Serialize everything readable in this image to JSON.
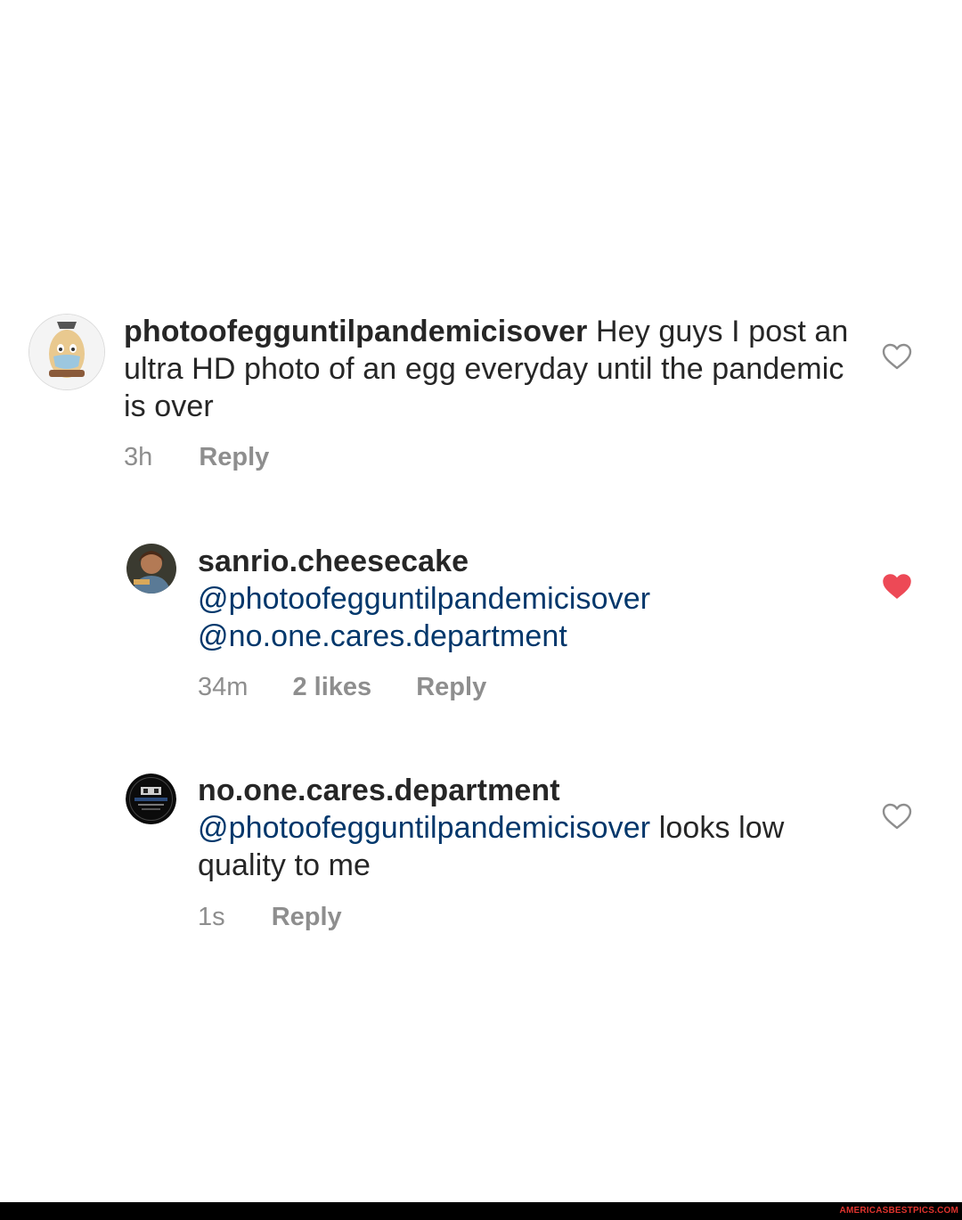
{
  "comments": [
    {
      "username": "photoofegguntilpandemicisover",
      "text": " Hey guys I post an ultra HD photo of an egg everyday until the pandemic is over",
      "time": "3h",
      "reply_label": "Reply",
      "liked": false
    },
    {
      "username": "sanrio.cheesecake",
      "mention1": "@photoofegguntilpandemicisover",
      "mention2": "@no.one.cares.department",
      "time": "34m",
      "likes": "2 likes",
      "reply_label": "Reply",
      "liked": true
    },
    {
      "username": "no.one.cares.department",
      "mention1": "@photoofegguntilpandemicisover",
      "text": " looks low quality to me",
      "time": "1s",
      "reply_label": "Reply",
      "liked": false
    }
  ],
  "watermark": "AMERICASBESTPICS.COM",
  "colors": {
    "heart_liked": "#ed4956",
    "heart_outline": "#8e8e8e",
    "mention": "#00376b",
    "meta": "#8e8e8e"
  }
}
